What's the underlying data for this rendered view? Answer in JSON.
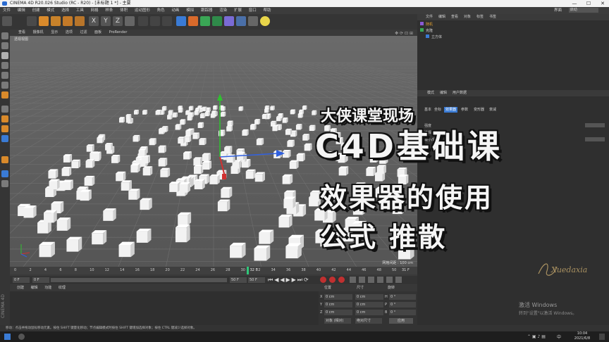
{
  "window": {
    "title": "CINEMA 4D R20.026 Studio (RC - R20) - [未标题 1 *] - 主要"
  },
  "window_controls": {
    "minimize": "—",
    "maximize": "☐",
    "close": "✕"
  },
  "menubar": {
    "items": [
      "文件",
      "编辑",
      "创建",
      "模式",
      "选择",
      "工具",
      "网格",
      "样条",
      "体积",
      "运动图形",
      "角色",
      "动画",
      "模拟",
      "跟踪器",
      "渲染",
      "扩展",
      "窗口",
      "帮助"
    ],
    "right_items": [
      "界面",
      "启动"
    ]
  },
  "viewport_menu": {
    "items": [
      "查看",
      "摄像机",
      "显示",
      "选项",
      "过滤",
      "面板",
      "ProRender"
    ],
    "view_label": "透视视图"
  },
  "viewport": {
    "grid_info": "网格间距 : 100 cm"
  },
  "timeline": {
    "ticks": [
      "0",
      "2",
      "4",
      "6",
      "8",
      "10",
      "12",
      "14",
      "16",
      "18",
      "20",
      "22",
      "24",
      "26",
      "28",
      "30",
      "32",
      "34",
      "36",
      "38",
      "40",
      "42",
      "44",
      "46",
      "48",
      "50"
    ],
    "current_frame": "30",
    "current_frame_label": "32 F",
    "end_label": "31 F",
    "start_field": "0 F",
    "start_field2": "0 F",
    "end_field": "50 F",
    "end_field2": "50 F"
  },
  "material_panel": {
    "tabs": [
      "创建",
      "编辑",
      "功能",
      "纹理"
    ]
  },
  "coord_panel": {
    "headers": [
      "位置",
      "尺寸",
      "旋转"
    ],
    "rows": [
      {
        "axis": "X",
        "pos": "0 cm",
        "size": "0 cm",
        "rot_axis": "H",
        "rot": "0 °"
      },
      {
        "axis": "Y",
        "pos": "0 cm",
        "size": "0 cm",
        "rot_axis": "P",
        "rot": "0 °"
      },
      {
        "axis": "Z",
        "pos": "0 cm",
        "size": "0 cm",
        "rot_axis": "B",
        "rot": "0 °"
      }
    ],
    "mode_select": "对象 (相对)",
    "size_select": "绝对尺寸",
    "apply_button": "应用"
  },
  "object_manager": {
    "tabs": [
      "文件",
      "编辑",
      "查看",
      "对象",
      "标签",
      "书签"
    ],
    "objects": [
      "随机",
      "克隆",
      "立方体"
    ]
  },
  "attributes": {
    "tabs": [
      "模式",
      "编辑",
      "用户数据"
    ],
    "subtabs": [
      "基本",
      "坐标",
      "效果器",
      "参数",
      "变形器",
      "衰减"
    ],
    "rows": [
      "强度",
      "选择",
      "最小/最大"
    ]
  },
  "overlay": {
    "line1": "大侠课堂现场",
    "line2": "C4D基础课",
    "line3": "效果器的使用",
    "line4": "公式 推散",
    "signature": "Xuedaxia"
  },
  "watermark": {
    "line1": "激活 Windows",
    "line2": "转到\"设置\"以激活 Windows。"
  },
  "statusbar": {
    "text": "移动：点击并拖动鼠标移动元素。按住 SHIFT 键量化移动；节点编辑模式时按住 SHIFT 键增加选择对象；按住 CTRL 键减少选择对象。"
  },
  "taskbar": {
    "time": "10:04",
    "date": "2021/6/8",
    "lang": "中"
  },
  "side_label": "CINEMA 4D",
  "colors": {
    "accent_blue": "#3a7bd5",
    "axis_x": "#d03030",
    "axis_y": "#30c030",
    "axis_z": "#3060e0",
    "frame_marker": "#2fc87a"
  }
}
